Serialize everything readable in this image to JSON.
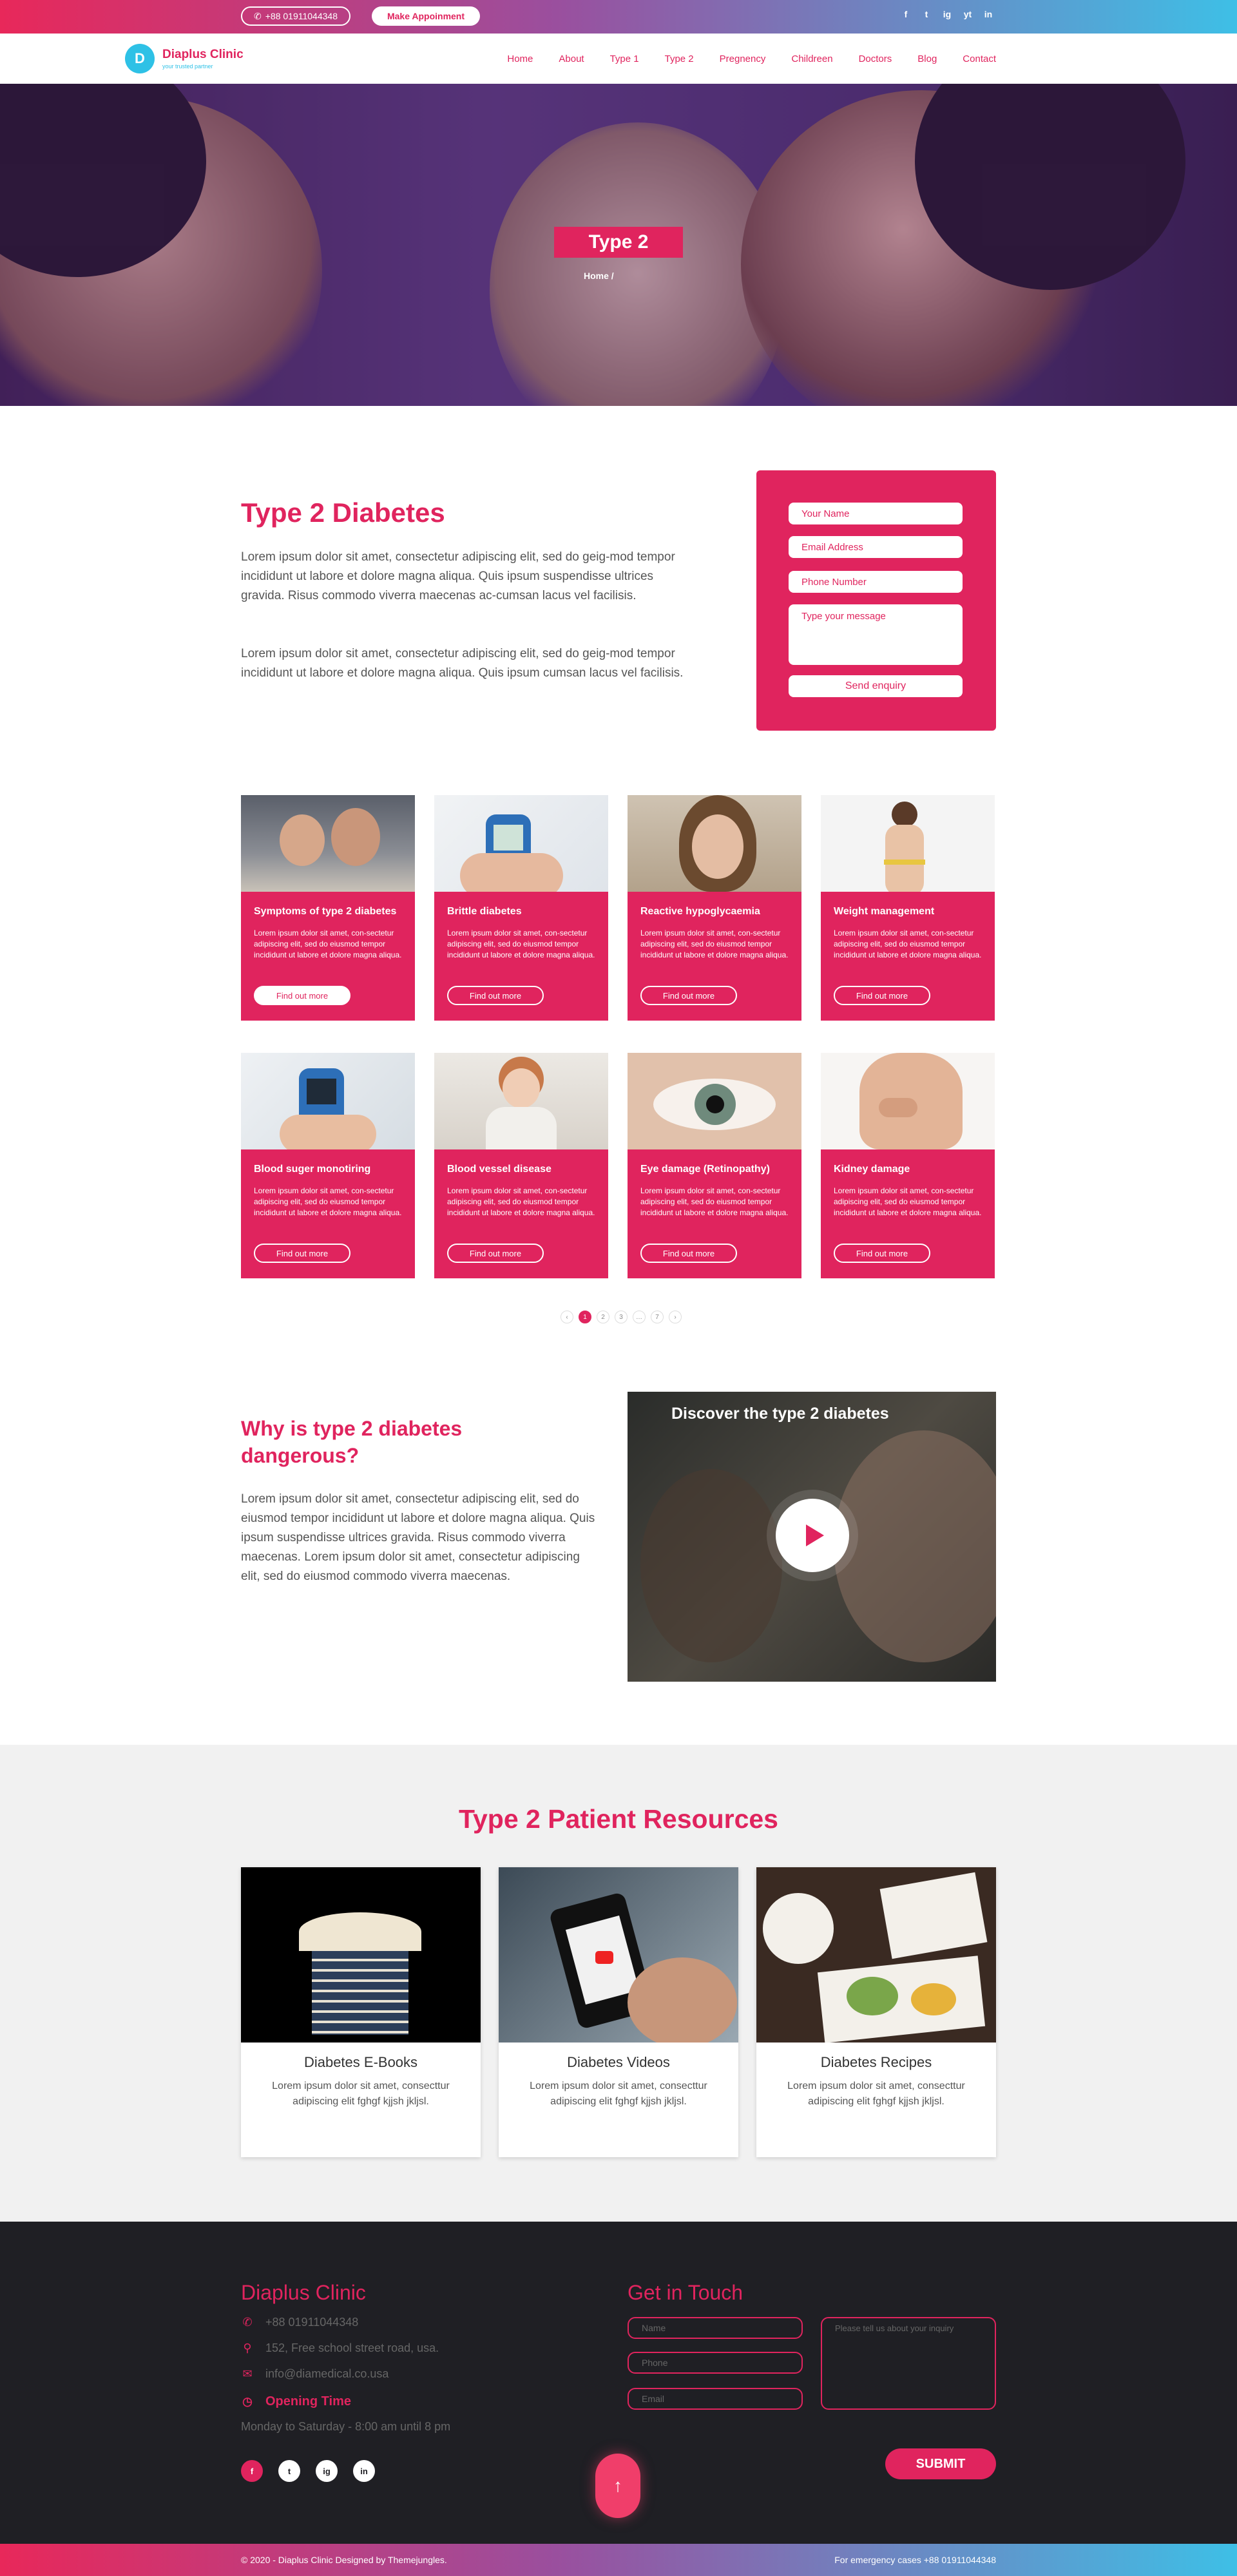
{
  "topbar": {
    "phone": "+88 01911044348",
    "appointment": "Make Appoinment",
    "social": [
      "f",
      "t",
      "ig",
      "yt",
      "in"
    ]
  },
  "brand": {
    "name": "Diaplus Clinic",
    "tagline": "your trusted partner",
    "mark": "D"
  },
  "nav": [
    "Home",
    "About",
    "Type 1",
    "Type 2",
    "Pregnency",
    "Childreen",
    "Doctors",
    "Blog",
    "Contact"
  ],
  "hero": {
    "title": "Type 2",
    "crumb": "Home /"
  },
  "intro": {
    "title": "Type 2 Diabetes",
    "p1": "Lorem ipsum dolor sit amet, consectetur adipiscing elit, sed do geig-mod tempor incididunt ut labore et dolore magna aliqua. Quis ipsum suspendisse ultrices gravida. Risus commodo viverra maecenas ac-cumsan lacus vel facilisis.",
    "p2": "Lorem ipsum dolor sit amet, consectetur adipiscing elit, sed do geig-mod tempor incididunt ut labore et dolore magna aliqua. Quis ipsum cumsan lacus vel facilisis."
  },
  "form": {
    "name": "Your Name",
    "email": "Email Address",
    "phone": "Phone Number",
    "message": "Type your message",
    "submit": "Send enquiry"
  },
  "cards_text": "Lorem ipsum dolor sit amet, con-sectetur adipiscing elit, sed do eiusmod tempor incididunt ut labore et dolore magna aliqua.",
  "cards_more": "Find out more",
  "cards": [
    {
      "title": "Symptoms of type 2 diabetes"
    },
    {
      "title": "Brittle diabetes"
    },
    {
      "title": "Reactive hypoglycaemia"
    },
    {
      "title": "Weight management"
    },
    {
      "title": "Blood suger monotiring"
    },
    {
      "title": "Blood vessel disease"
    },
    {
      "title": "Eye damage (Retinopathy)"
    },
    {
      "title": "Kidney damage"
    }
  ],
  "pager": [
    "‹",
    "1",
    "2",
    "3",
    "…",
    "7",
    "›"
  ],
  "why": {
    "title": "Why is type 2 diabetes dangerous?",
    "text": "Lorem ipsum dolor sit amet, consectetur adipiscing elit, sed do eiusmod tempor incididunt ut labore et dolore magna aliqua. Quis ipsum suspendisse ultrices gravida. Risus commodo viverra maecenas. Lorem ipsum dolor sit amet, consectetur adipiscing elit, sed do eiusmod commodo viverra maecenas.",
    "video_title": "Discover the type 2 diabetes"
  },
  "resources": {
    "title": "Type 2 Patient Resources",
    "text": "Lorem ipsum dolor sit amet, consecttur adipiscing elit fghgf kjjsh jkljsl.",
    "items": [
      "Diabetes E-Books",
      "Diabetes Videos",
      "Diabetes Recipes"
    ]
  },
  "footer": {
    "title": "Diaplus Clinic",
    "phone": "+88 01911044348",
    "address": "152, Free school street road, usa.",
    "email": "info@diamedical.co.usa",
    "hours_title": "Opening Time",
    "hours": "Monday to Saturday - 8:00 am until 8 pm",
    "social": [
      "f",
      "t",
      "ig",
      "in"
    ],
    "contact_title": "Get in Touch",
    "name_ph": "Name",
    "phone_ph": "Phone",
    "email_ph": "Email",
    "inquiry_ph": "Please tell us about your inquiry",
    "submit": "SUBMIT"
  },
  "bottombar": {
    "copyright": "© 2020 - Diaplus Clinic Designed by Themejungles.",
    "emergency": "For emergency cases +88 01911044348"
  },
  "colors": {
    "accent": "#e0245e",
    "cyan": "#2ec1e6",
    "footer": "#1f1f24"
  }
}
